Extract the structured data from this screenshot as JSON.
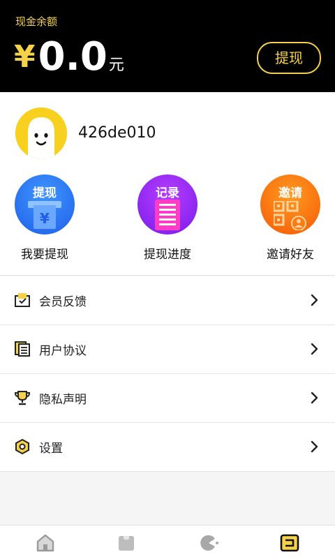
{
  "header": {
    "balance_label": "现金余额",
    "currency_symbol": "¥",
    "amount": "0.0",
    "unit": "元",
    "withdraw_label": "提现",
    "accent_color": "#f5d24a"
  },
  "profile": {
    "avatar_icon": "ghost-face-avatar",
    "username": "426de010"
  },
  "actions": [
    {
      "badge": "提现",
      "label": "我要提现",
      "icon": "withdraw-yen-icon",
      "color": "#2f7ff5"
    },
    {
      "badge": "记录",
      "label": "提现进度",
      "icon": "record-list-icon",
      "color": "#8a25f0"
    },
    {
      "badge": "邀请",
      "label": "邀请好友",
      "icon": "qr-invite-icon",
      "color": "#ff7a10"
    }
  ],
  "menu": [
    {
      "label": "会员反馈",
      "icon": "feedback-icon"
    },
    {
      "label": "用户协议",
      "icon": "document-icon"
    },
    {
      "label": "隐私声明",
      "icon": "trophy-icon"
    },
    {
      "label": "设置",
      "icon": "settings-nut-icon"
    }
  ],
  "tabbar": [
    {
      "icon": "home-icon",
      "active": false
    },
    {
      "icon": "bag-icon",
      "active": false
    },
    {
      "icon": "game-icon",
      "active": false
    },
    {
      "icon": "profile-icon",
      "active": true
    }
  ]
}
